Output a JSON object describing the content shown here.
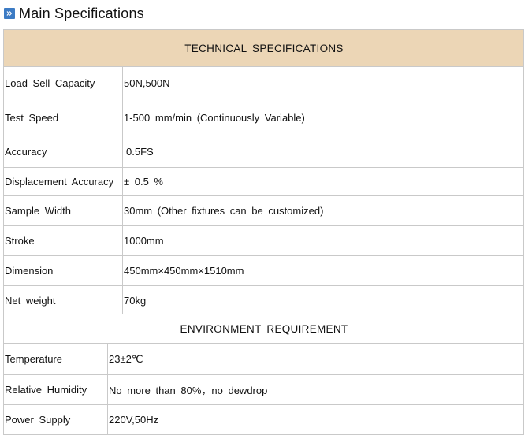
{
  "section": {
    "title": "Main Specifications",
    "icon": "double-chevron-right-icon",
    "accent_color": "#3c7bc4"
  },
  "technical": {
    "header": "TECHNICAL  SPECIFICATIONS",
    "header_bg": "#ecd6b6",
    "rows": [
      {
        "label": "Load Sell Capacity",
        "value": "50N,500N"
      },
      {
        "label": "Test Speed",
        "value": "1-500 mm/min (Continuously Variable)"
      },
      {
        "label": "Accuracy",
        "value": "0.5FS"
      },
      {
        "label": "Displacement Accuracy",
        "value": "± 0.5 %"
      },
      {
        "label": "Sample Width",
        "value": "30mm (Other fixtures can be customized)"
      },
      {
        "label": "Stroke",
        "value": "1000mm"
      },
      {
        "label": "Dimension",
        "value": "450mm×450mm×1510mm"
      },
      {
        "label": "Net weight",
        "value": "70kg"
      }
    ]
  },
  "environment": {
    "header": "ENVIRONMENT  REQUIREMENT",
    "rows": [
      {
        "label": "Temperature",
        "value": "23±2℃"
      },
      {
        "label": "Relative Humidity",
        "value": "No more than 80%，no dewdrop"
      },
      {
        "label": "Power Supply",
        "value": "220V,50Hz"
      }
    ]
  }
}
